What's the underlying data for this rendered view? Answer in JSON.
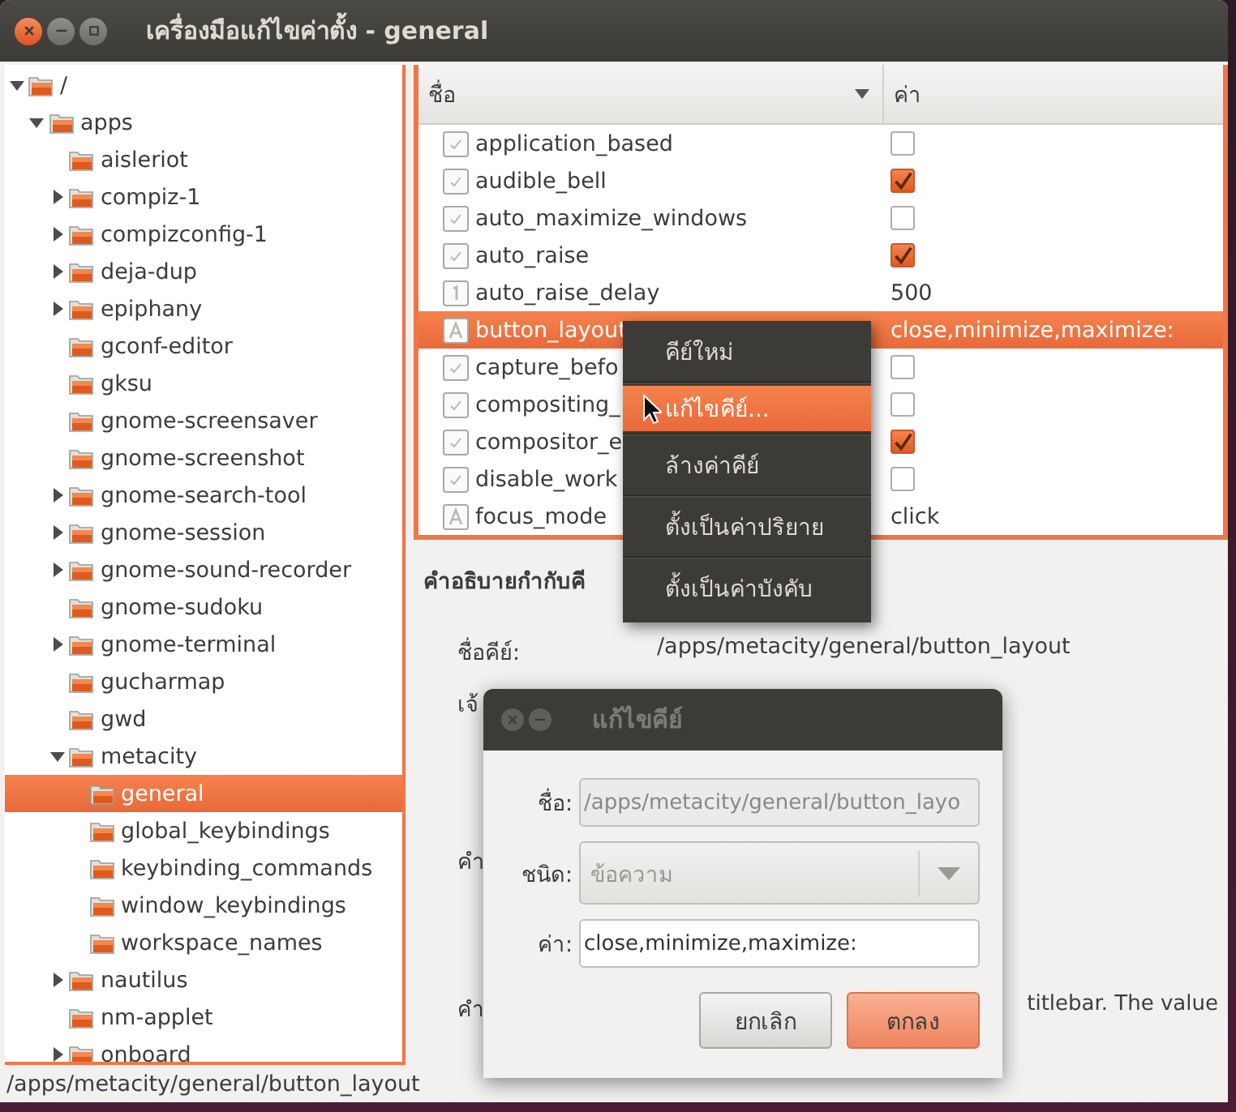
{
  "window": {
    "title": "เครื่องมือแก้ไขค่าตั้ง - general"
  },
  "tree": [
    {
      "label": "/",
      "kind": "branch",
      "expanded": true,
      "selected": false,
      "children": [
        {
          "label": "apps",
          "kind": "branch",
          "expanded": true,
          "selected": false,
          "children": [
            {
              "label": "aisleriot",
              "kind": "leaf",
              "selected": false
            },
            {
              "label": "compiz-1",
              "kind": "branch",
              "expanded": false,
              "selected": false
            },
            {
              "label": "compizconfig-1",
              "kind": "branch",
              "expanded": false,
              "selected": false
            },
            {
              "label": "deja-dup",
              "kind": "branch",
              "expanded": false,
              "selected": false
            },
            {
              "label": "epiphany",
              "kind": "branch",
              "expanded": false,
              "selected": false
            },
            {
              "label": "gconf-editor",
              "kind": "leaf",
              "selected": false
            },
            {
              "label": "gksu",
              "kind": "leaf",
              "selected": false
            },
            {
              "label": "gnome-screensaver",
              "kind": "leaf",
              "selected": false
            },
            {
              "label": "gnome-screenshot",
              "kind": "leaf",
              "selected": false
            },
            {
              "label": "gnome-search-tool",
              "kind": "branch",
              "expanded": false,
              "selected": false
            },
            {
              "label": "gnome-session",
              "kind": "branch",
              "expanded": false,
              "selected": false
            },
            {
              "label": "gnome-sound-recorder",
              "kind": "branch",
              "expanded": false,
              "selected": false
            },
            {
              "label": "gnome-sudoku",
              "kind": "leaf",
              "selected": false
            },
            {
              "label": "gnome-terminal",
              "kind": "branch",
              "expanded": false,
              "selected": false
            },
            {
              "label": "gucharmap",
              "kind": "leaf",
              "selected": false
            },
            {
              "label": "gwd",
              "kind": "leaf",
              "selected": false
            },
            {
              "label": "metacity",
              "kind": "branch",
              "expanded": true,
              "selected": false,
              "children": [
                {
                  "label": "general",
                  "kind": "leaf",
                  "selected": true
                },
                {
                  "label": "global_keybindings",
                  "kind": "leaf",
                  "selected": false
                },
                {
                  "label": "keybinding_commands",
                  "kind": "leaf",
                  "selected": false
                },
                {
                  "label": "window_keybindings",
                  "kind": "leaf",
                  "selected": false
                },
                {
                  "label": "workspace_names",
                  "kind": "leaf",
                  "selected": false
                }
              ]
            },
            {
              "label": "nautilus",
              "kind": "branch",
              "expanded": false,
              "selected": false
            },
            {
              "label": "nm-applet",
              "kind": "leaf",
              "selected": false
            },
            {
              "label": "onboard",
              "kind": "branch",
              "expanded": false,
              "selected": false
            }
          ]
        }
      ]
    }
  ],
  "table": {
    "columns": [
      {
        "label": "ชื่อ",
        "sorted": true
      },
      {
        "label": "ค่า",
        "sorted": false
      }
    ],
    "rows": [
      {
        "name": "application_based",
        "kind": "bool",
        "checked": false,
        "selected": false
      },
      {
        "name": "audible_bell",
        "kind": "bool",
        "checked": true,
        "selected": false
      },
      {
        "name": "auto_maximize_windows",
        "kind": "bool",
        "checked": false,
        "selected": false
      },
      {
        "name": "auto_raise",
        "kind": "bool",
        "checked": true,
        "selected": false
      },
      {
        "name": "auto_raise_delay",
        "kind": "int",
        "value": "500",
        "selected": false
      },
      {
        "name": "button_layout",
        "kind": "string",
        "value": "close,minimize,maximize:",
        "selected": true
      },
      {
        "name": "capture_befo",
        "kind": "bool",
        "checked": false,
        "selected": false
      },
      {
        "name": "compositing_",
        "kind": "bool",
        "checked": false,
        "selected": false
      },
      {
        "name": "compositor_e",
        "kind": "bool",
        "checked": true,
        "selected": false
      },
      {
        "name": "disable_work",
        "kind": "bool",
        "checked": false,
        "selected": false
      },
      {
        "name": "focus_mode",
        "kind": "string",
        "value": "click",
        "selected": false
      }
    ]
  },
  "context_menu": [
    {
      "label": "คีย์ใหม่",
      "selected": false
    },
    {
      "label": "แก้ไขคีย์...",
      "selected": true
    },
    {
      "label": "ล้างค่าคีย์",
      "selected": false
    },
    {
      "label": "ตั้งเป็นค่าปริยาย",
      "selected": false
    },
    {
      "label": "ตั้งเป็นค่าบังคับ",
      "selected": false
    }
  ],
  "details": {
    "heading": "คำอธิบายกำกับคี",
    "rows": [
      {
        "label": "ชื่อคีย์:",
        "value": "/apps/metacity/general/button_layout"
      },
      {
        "label": "เจ้"
      },
      {
        "label": "คำ"
      },
      {
        "label": "คำ",
        "value": "titlebar. The value"
      }
    ]
  },
  "dialog": {
    "title": "แก้ไขคีย์",
    "name_label": "ชื่อ:",
    "name_value": "/apps/metacity/general/button_layo",
    "type_label": "ชนิด:",
    "type_value": "ข้อความ",
    "value_label": "ค่า:",
    "value": "close,minimize,maximize:",
    "buttons": [
      {
        "label": "ยกเลิก",
        "kind": "secondary"
      },
      {
        "label": "ตกลง",
        "kind": "primary"
      }
    ]
  },
  "status_bar": "/apps/metacity/general/button_layout"
}
